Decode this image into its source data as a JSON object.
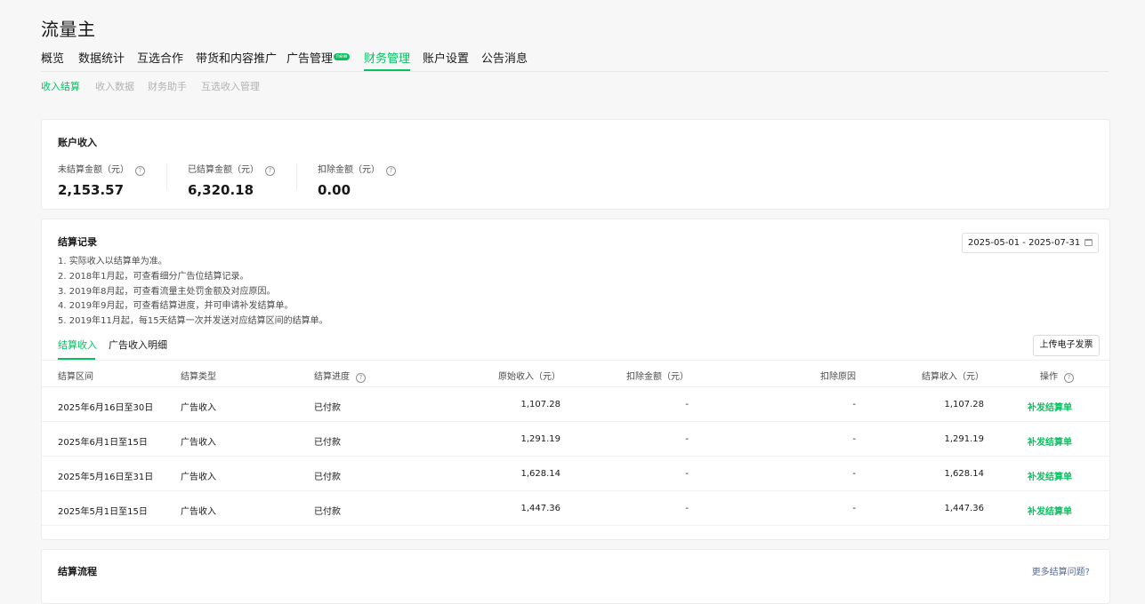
{
  "app_title": "流量主",
  "main_nav": [
    {
      "label": "概览",
      "active": false
    },
    {
      "label": "数据统计",
      "active": false
    },
    {
      "label": "互选合作",
      "active": false
    },
    {
      "label": "带货和内容推广",
      "active": false
    },
    {
      "label": "广告管理",
      "active": false,
      "badge": "new"
    },
    {
      "label": "财务管理",
      "active": true
    },
    {
      "label": "账户设置",
      "active": false
    },
    {
      "label": "公告消息",
      "active": false
    }
  ],
  "sub_nav": [
    {
      "label": "收入结算",
      "active": true
    },
    {
      "label": "收入数据",
      "active": false
    },
    {
      "label": "财务助手",
      "active": false
    },
    {
      "label": "互选收入管理",
      "active": false
    }
  ],
  "account_income": {
    "title": "账户收入",
    "metrics": [
      {
        "label": "未结算金额（元）",
        "value": "2,153.57"
      },
      {
        "label": "已结算金额（元）",
        "value": "6,320.18"
      },
      {
        "label": "扣除金额（元）",
        "value": "0.00"
      }
    ]
  },
  "settlement_records": {
    "title": "结算记录",
    "notes": [
      "1. 实际收入以结算单为准。",
      "2. 2018年1月起，可查看细分广告位结算记录。",
      "3. 2019年8月起，可查看流量主处罚金额及对应原因。",
      "4. 2019年9月起，可查看结算进度，并可申请补发结算单。",
      "5. 2019年11月起，每15天结算一次并发送对应结算区间的结算单。"
    ],
    "date_range": "2025-05-01 - 2025-07-31",
    "tabs": [
      {
        "label": "结算收入",
        "active": true
      },
      {
        "label": "广告收入明细",
        "active": false
      }
    ],
    "upload_button": "上传电子发票",
    "columns": [
      "结算区间",
      "结算类型",
      "结算进度",
      "原始收入（元）",
      "扣除金额（元）",
      "扣除原因",
      "结算收入（元）",
      "操作"
    ],
    "rows": [
      {
        "period": "2025年6月16日至30日",
        "type": "广告收入",
        "progress": "已付款",
        "original": "1,107.28",
        "deducted": "-",
        "reason": "-",
        "settled": "1,107.28",
        "action": "补发结算单"
      },
      {
        "period": "2025年6月1日至15日",
        "type": "广告收入",
        "progress": "已付款",
        "original": "1,291.19",
        "deducted": "-",
        "reason": "-",
        "settled": "1,291.19",
        "action": "补发结算单"
      },
      {
        "period": "2025年5月16日至31日",
        "type": "广告收入",
        "progress": "已付款",
        "original": "1,628.14",
        "deducted": "-",
        "reason": "-",
        "settled": "1,628.14",
        "action": "补发结算单"
      },
      {
        "period": "2025年5月1日至15日",
        "type": "广告收入",
        "progress": "已付款",
        "original": "1,447.36",
        "deducted": "-",
        "reason": "-",
        "settled": "1,447.36",
        "action": "补发结算单"
      }
    ]
  },
  "settlement_flow": {
    "title": "结算流程",
    "more_link": "更多结算问题?"
  },
  "colors": {
    "accent": "#07c160",
    "link": "#576b95",
    "background": "#f7f7f7"
  },
  "icons": [
    "help-icon",
    "calendar-icon"
  ]
}
